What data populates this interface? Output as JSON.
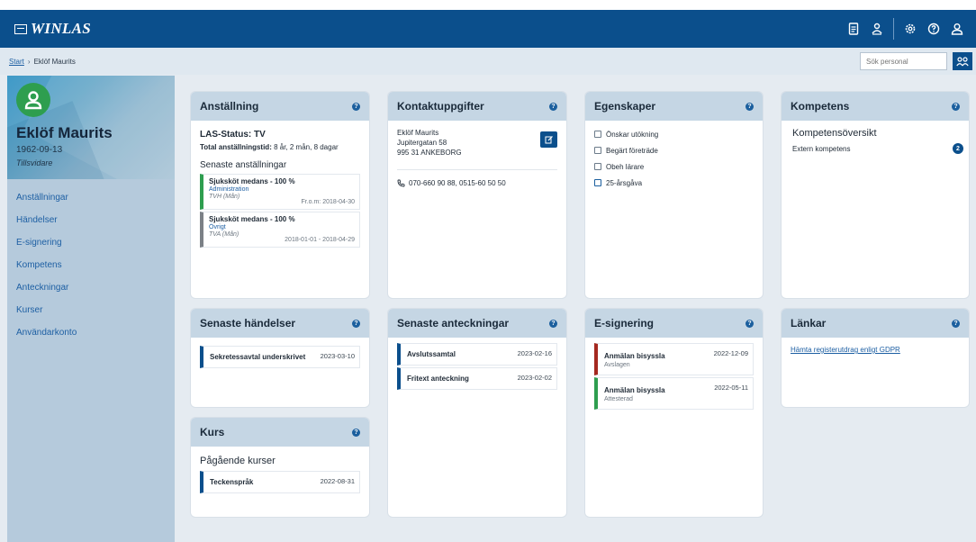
{
  "app": {
    "name": "WINLAS"
  },
  "breadcrumb": {
    "start": "Start",
    "current": "Eklöf Maurits"
  },
  "search": {
    "placeholder": "Sök personal"
  },
  "profile": {
    "name": "Eklöf Maurits",
    "dob": "1962-09-13",
    "role": "Tillsvidare"
  },
  "nav": [
    "Anställningar",
    "Händelser",
    "E-signering",
    "Kompetens",
    "Anteckningar",
    "Kurser",
    "Användarkonto"
  ],
  "employment": {
    "title": "Anställning",
    "status": "LAS-Status: TV",
    "total_label": "Total anställningstid:",
    "total_value": "8 år, 2 mån, 8 dagar",
    "recent_heading": "Senaste anställningar",
    "items": [
      {
        "title": "Sjuksköt medans - 100 %",
        "unit": "Administration",
        "code": "TVH (Mån)",
        "date": "Fr.o.m: 2018-04-30"
      },
      {
        "title": "Sjuksköt medans - 100 %",
        "unit": "Övrigt",
        "code": "TVA (Mån)",
        "date": "2018-01-01 - 2018-04-29"
      }
    ]
  },
  "contact": {
    "title": "Kontaktuppgifter",
    "name": "Eklöf Maurits",
    "street": "Jupitergatan 58",
    "city": "995 31 ANKEBORG",
    "phone": "070-660 90 88, 0515-60 50 50"
  },
  "properties": {
    "title": "Egenskaper",
    "items": [
      "Önskar utökning",
      "Begärt företräde",
      "Obeh lärare",
      "25-årsgåva"
    ]
  },
  "competence": {
    "title": "Kompetens",
    "heading": "Kompetensöversikt",
    "row_label": "Extern kompetens",
    "row_count": "2"
  },
  "events": {
    "title": "Senaste händelser",
    "items": [
      {
        "title": "Sekretessavtal underskrivet",
        "date": "2023-03-10"
      }
    ]
  },
  "notes": {
    "title": "Senaste anteckningar",
    "items": [
      {
        "title": "Avslutssamtal",
        "date": "2023-02-16"
      },
      {
        "title": "Fritext anteckning",
        "date": "2023-02-02"
      }
    ]
  },
  "esign": {
    "title": "E-signering",
    "items": [
      {
        "title": "Anmälan bisyssla",
        "status": "Avslagen",
        "date": "2022-12-09"
      },
      {
        "title": "Anmälan bisyssla",
        "status": "Attesterad",
        "date": "2022-05-11"
      }
    ]
  },
  "links": {
    "title": "Länkar",
    "items": [
      "Hämta registerutdrag enligt GDPR"
    ]
  },
  "course": {
    "title": "Kurs",
    "heading": "Pågående kurser",
    "items": [
      {
        "title": "Teckenspråk",
        "date": "2022-08-31"
      }
    ]
  },
  "colors": {
    "brand": "#0b4f8c",
    "accent_green": "#2e9e4f",
    "accent_red": "#a4281f",
    "card_header": "#c5d6e4"
  }
}
